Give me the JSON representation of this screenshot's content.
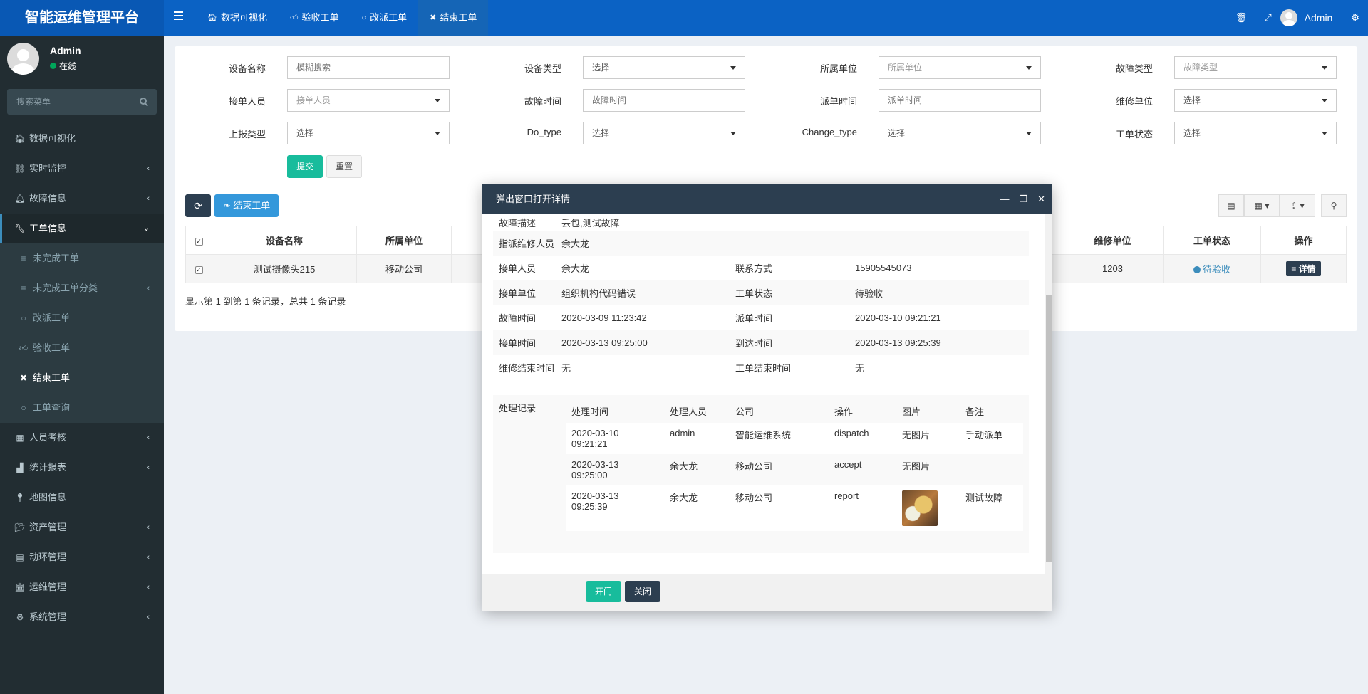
{
  "app": {
    "title": "智能运维管理平台"
  },
  "topnav": {
    "tabs": [
      {
        "icon": "dashboard-icon",
        "label": "数据可视化"
      },
      {
        "icon": "thumbs-up-icon",
        "label": "验收工单"
      },
      {
        "icon": "circle-icon",
        "label": "改派工单"
      },
      {
        "icon": "close-icon",
        "label": "结束工单",
        "active": true
      }
    ],
    "user": "Admin"
  },
  "sidebar": {
    "user": {
      "name": "Admin",
      "status": "在线"
    },
    "search_placeholder": "搜索菜单",
    "menu": [
      {
        "icon": "dashboard-icon",
        "label": "数据可视化"
      },
      {
        "icon": "binoculars-icon",
        "label": "实时监控",
        "arrow": "‹"
      },
      {
        "icon": "bell-icon",
        "label": "故障信息",
        "arrow": "‹"
      },
      {
        "icon": "wrench-icon",
        "label": "工单信息",
        "arrow": "⌄",
        "open": true
      }
    ],
    "submenu": [
      {
        "icon": "list-icon",
        "label": "未完成工单"
      },
      {
        "icon": "list-icon",
        "label": "未完成工单分类",
        "arrow": "‹"
      },
      {
        "icon": "circle-icon",
        "label": "改派工单"
      },
      {
        "icon": "thumbs-up-icon",
        "label": "验收工单"
      },
      {
        "icon": "close-icon",
        "label": "结束工单",
        "current": true
      },
      {
        "icon": "circle-icon",
        "label": "工单查询"
      }
    ],
    "menu2": [
      {
        "icon": "table-icon",
        "label": "人员考核",
        "arrow": "‹"
      },
      {
        "icon": "area-chart-icon",
        "label": "统计报表",
        "arrow": "‹"
      },
      {
        "icon": "map-marker-icon",
        "label": "地图信息"
      },
      {
        "icon": "folder-icon",
        "label": "资产管理",
        "arrow": "‹"
      },
      {
        "icon": "server-icon",
        "label": "动环管理",
        "arrow": "‹"
      },
      {
        "icon": "bank-icon",
        "label": "运维管理",
        "arrow": "‹"
      },
      {
        "icon": "cogs-icon",
        "label": "系统管理",
        "arrow": "‹"
      }
    ]
  },
  "filters": {
    "row1": [
      {
        "label": "设备名称",
        "placeholder": "模糊搜索",
        "type": "text"
      },
      {
        "label": "设备类型",
        "value": "选择",
        "type": "select"
      },
      {
        "label": "所属单位",
        "value": "所属单位",
        "type": "select",
        "muted": true
      },
      {
        "label": "故障类型",
        "value": "故障类型",
        "type": "select",
        "muted": true
      }
    ],
    "row2": [
      {
        "label": "接单人员",
        "value": "接单人员",
        "type": "select",
        "muted": true
      },
      {
        "label": "故障时间",
        "placeholder": "故障时间",
        "type": "text"
      },
      {
        "label": "派单时间",
        "placeholder": "派单时间",
        "type": "text"
      },
      {
        "label": "维修单位",
        "value": "选择",
        "type": "select"
      }
    ],
    "row3": [
      {
        "label": "上报类型",
        "value": "选择",
        "type": "select"
      },
      {
        "label": "Do_type",
        "value": "选择",
        "type": "select"
      },
      {
        "label": "Change_type",
        "value": "选择",
        "type": "select"
      },
      {
        "label": "工单状态",
        "value": "选择",
        "type": "select"
      }
    ],
    "submit": "提交",
    "reset": "重置"
  },
  "toolbar": {
    "end_label": "结束工单"
  },
  "table": {
    "headers": [
      "设备名称",
      "所属单位",
      "维修单位",
      "工单状态",
      "操作"
    ],
    "row": {
      "device": "测试摄像头215",
      "unit": "移动公司",
      "repair_unit": "1203",
      "status": "待验收",
      "action": "详情"
    },
    "info": "显示第 1 到第 1 条记录，总共 1 条记录"
  },
  "modal": {
    "title": "弹出窗口打开详情",
    "fault_desc": {
      "k": "故障描述",
      "v": "丢包,测试故障"
    },
    "assignee": {
      "k": "指派维修人员",
      "v": "余大龙"
    },
    "pairs": [
      [
        {
          "k": "接单人员",
          "v": "余大龙"
        },
        {
          "k": "联系方式",
          "v": "15905545073"
        }
      ],
      [
        {
          "k": "接单单位",
          "v": "组织机构代码错误"
        },
        {
          "k": "工单状态",
          "v": "待验收"
        }
      ],
      [
        {
          "k": "故障时间",
          "v": "2020-03-09 11:23:42"
        },
        {
          "k": "派单时间",
          "v": "2020-03-10 09:21:21"
        }
      ],
      [
        {
          "k": "接单时间",
          "v": "2020-03-13 09:25:00"
        },
        {
          "k": "到达时间",
          "v": "2020-03-13 09:25:39"
        }
      ],
      [
        {
          "k": "维修结束时间",
          "v": "无"
        },
        {
          "k": "工单结束时间",
          "v": "无"
        }
      ]
    ],
    "records_label": "处理记录",
    "records_headers": [
      "处理时间",
      "处理人员",
      "公司",
      "操作",
      "图片",
      "备注"
    ],
    "records": [
      {
        "time1": "2020-03-10",
        "time2": "09:21:21",
        "person": "admin",
        "company": "智能运维系统",
        "op": "dispatch",
        "image": "无图片",
        "note": "手动派单"
      },
      {
        "time1": "2020-03-13",
        "time2": "09:25:00",
        "person": "余大龙",
        "company": "移动公司",
        "op": "accept",
        "image": "无图片",
        "note": ""
      },
      {
        "time1": "2020-03-13",
        "time2": "09:25:39",
        "person": "余大龙",
        "company": "移动公司",
        "op": "report",
        "image": "",
        "note": "测试故障"
      }
    ],
    "open_btn": "开门",
    "close_btn": "关闭"
  }
}
